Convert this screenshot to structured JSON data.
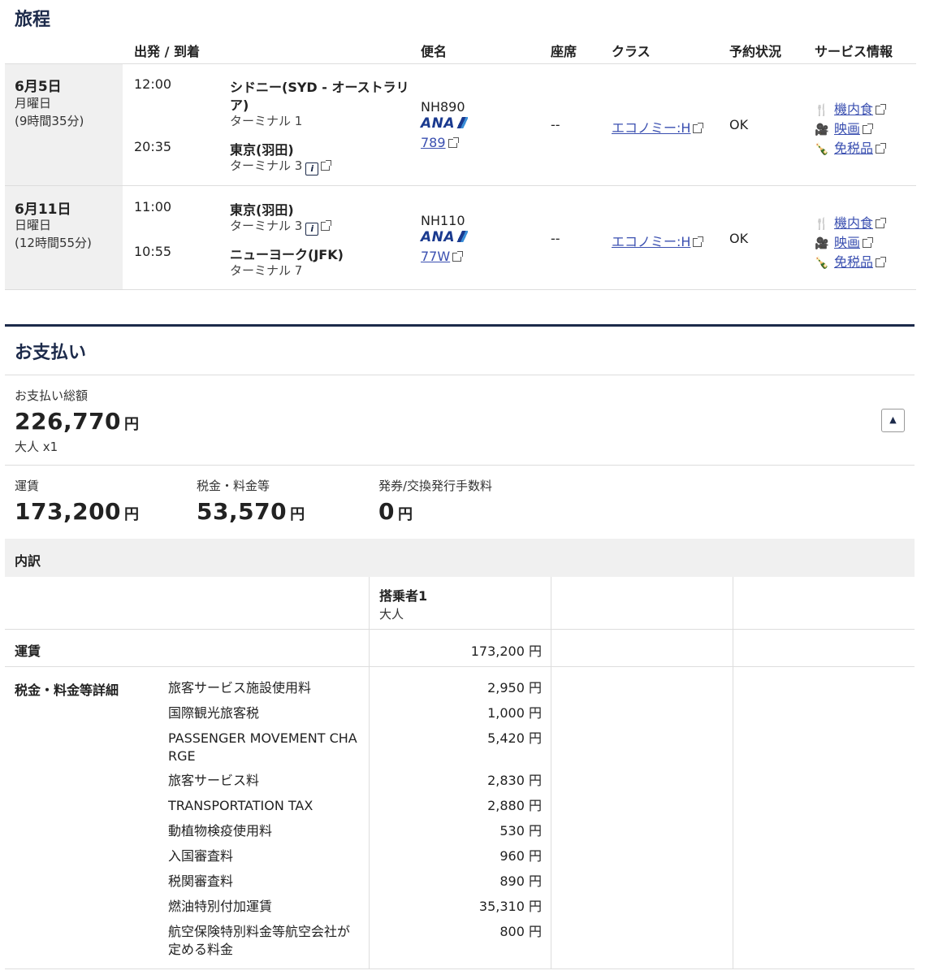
{
  "itinerary": {
    "title": "旅程",
    "headers": {
      "dep_arr": "出発 / 到着",
      "flight": "便名",
      "seat": "座席",
      "class": "クラス",
      "status": "予約状況",
      "service": "サービス情報"
    },
    "legs": [
      {
        "date": "6月5日",
        "weekday": "月曜日",
        "duration": "(9時間35分)",
        "dep_time": "12:00",
        "dep_place_1": "シドニー(SYD - オーストラリ",
        "dep_place_2": "ア)",
        "dep_terminal": "ターミナル 1",
        "arr_time": "20:35",
        "arr_place": "東京(羽田)",
        "arr_terminal": "ターミナル 3",
        "flight_no": "NH890",
        "airline": "ANA",
        "aircraft": "789",
        "seat": "--",
        "class": "エコノミー:H",
        "status": "OK",
        "svc_meal": "機内食",
        "svc_movie": "映画",
        "svc_dutyfree": "免税品"
      },
      {
        "date": "6月11日",
        "weekday": "日曜日",
        "duration": "(12時間55分)",
        "dep_time": "11:00",
        "dep_place": "東京(羽田)",
        "dep_terminal": "ターミナル 3",
        "arr_time": "10:55",
        "arr_place": "ニューヨーク(JFK)",
        "arr_terminal": "ターミナル 7",
        "flight_no": "NH110",
        "airline": "ANA",
        "aircraft": "77W",
        "seat": "--",
        "class": "エコノミー:H",
        "status": "OK",
        "svc_meal": "機内食",
        "svc_movie": "映画",
        "svc_dutyfree": "免税品"
      }
    ]
  },
  "payment": {
    "title": "お支払い",
    "total_label": "お支払い総額",
    "total_value": "226,770",
    "yen": "円",
    "pax_summary": "大人 x1",
    "fare_label": "運賃",
    "fare_value": "173,200",
    "tax_label": "税金・料金等",
    "tax_value": "53,570",
    "fee_label": "発券/交換発行手数料",
    "fee_value": "0"
  },
  "breakdown": {
    "title": "内訳",
    "passenger_label": "搭乗者1",
    "passenger_type": "大人",
    "fare_row_label": "運賃",
    "fare_row_value": "173,200 円",
    "tax_section_label": "税金・料金等詳細",
    "tax_items": [
      {
        "name": "旅客サービス施設使用料",
        "value": "2,950 円"
      },
      {
        "name": "国際観光旅客税",
        "value": "1,000 円"
      },
      {
        "name": "PASSENGER MOVEMENT CHA",
        "name2": "RGE",
        "value": "5,420 円"
      },
      {
        "name": "旅客サービス料",
        "value": "2,830 円"
      },
      {
        "name": "TRANSPORTATION TAX",
        "value": "2,880 円"
      },
      {
        "name": "動植物検疫使用料",
        "value": "530 円"
      },
      {
        "name": "入国審査料",
        "value": "960 円"
      },
      {
        "name": "税関審査料",
        "value": "890 円"
      },
      {
        "name": "燃油特別付加運賃",
        "value": "35,310 円"
      },
      {
        "name": "航空保険特別料金等航空会社が",
        "name2": "定める料金",
        "value": "800 円"
      }
    ]
  }
}
